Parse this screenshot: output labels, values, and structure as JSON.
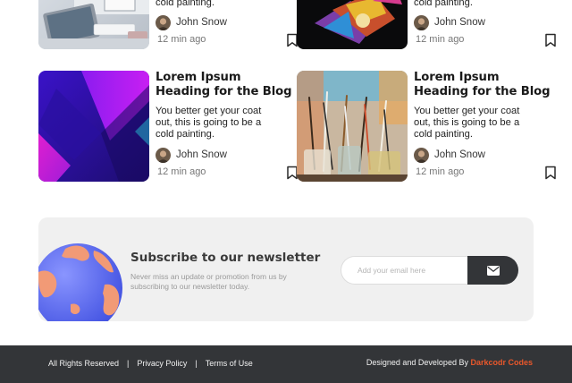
{
  "cards": [
    {
      "excerpt_tail": "cold painting.",
      "author": "John Snow",
      "time": "12 min ago",
      "image": "desk-computer-photo",
      "icons": {
        "bookmark": "bookmark-icon"
      }
    },
    {
      "excerpt_tail": "cold painting.",
      "author": "John Snow",
      "time": "12 min ago",
      "image": "colorful-abstract-photo",
      "icons": {
        "bookmark": "bookmark-icon"
      }
    },
    {
      "heading_line1": "Lorem Ipsum",
      "heading_line2": "Heading for the Blog",
      "excerpt_line1": "You better get your coat",
      "excerpt_line2": "out, this is going to be a",
      "excerpt_line3": "cold painting.",
      "author": "John Snow",
      "time": "12 min ago",
      "image": "purple-gradient-graphic",
      "icons": {
        "bookmark": "bookmark-icon"
      }
    },
    {
      "heading_line1": "Lorem Ipsum",
      "heading_line2": "Heading for the Blog",
      "excerpt_line1": "You better get your coat",
      "excerpt_line2": "out, this is going to be a",
      "excerpt_line3": "cold painting.",
      "author": "John Snow",
      "time": "12 min ago",
      "image": "paint-brushes-photo",
      "icons": {
        "bookmark": "bookmark-icon"
      }
    }
  ],
  "newsletter": {
    "title": "Subscribe to our newsletter",
    "subtitle_line1": "Never miss an update or promotion from us by",
    "subtitle_line2": "subscribing to our newsletter today.",
    "placeholder": "Add your email here",
    "illustration": "globe-illustration",
    "button_icon": "envelope-icon"
  },
  "footer": {
    "rights": "All Rights Reserved",
    "separator": "|",
    "privacy": "Privacy Policy",
    "terms": "Terms of Use",
    "credit_prefix": "Designed and Developed By",
    "credit_brand": "Darkcodr Codes"
  },
  "colors": {
    "footer_bg": "#333538",
    "brand_accent": "#e8572b",
    "newsletter_bg": "#f0f0f0"
  }
}
